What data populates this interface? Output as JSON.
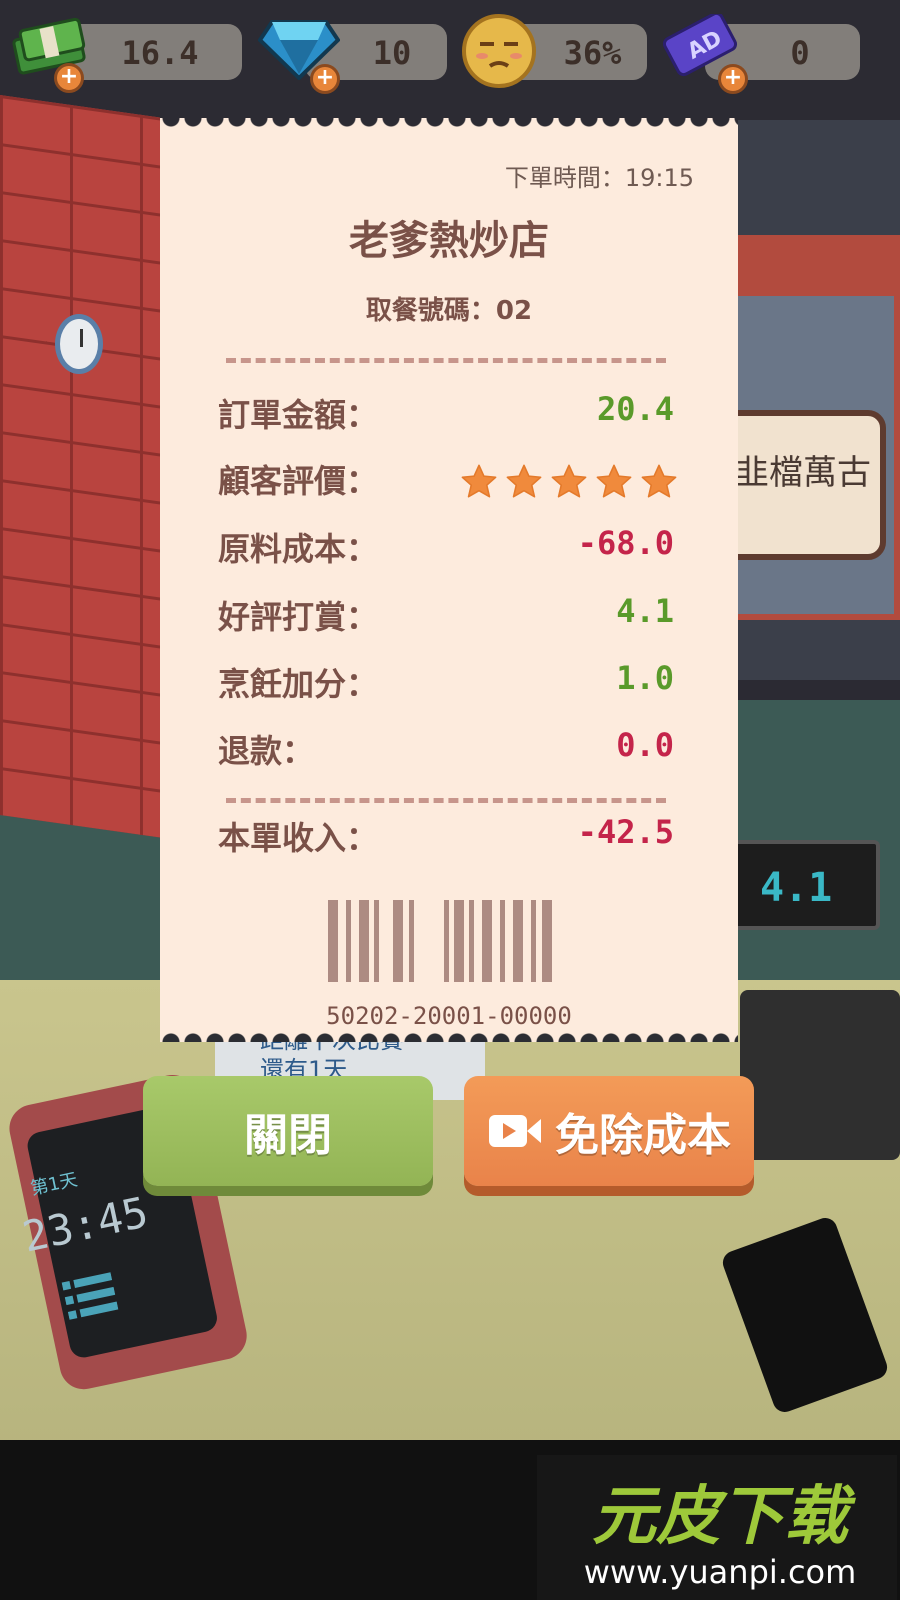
{
  "hud": {
    "cash": "16.4",
    "gems": "10",
    "mood": "36%",
    "ad_tickets": "0",
    "plus_symbol": "+",
    "ad_logo_text": "AD",
    "icons": [
      "cash-icon",
      "gem-icon",
      "mood-face-icon",
      "ad-ticket-icon",
      "plus-icon"
    ]
  },
  "background": {
    "sign_text": "韭檔萬古",
    "display_value": "4.1",
    "behind_text_line1": "距離下次比賽",
    "behind_text_line2": "還有1天",
    "tablet_day": "第1天",
    "tablet_time": "23:45"
  },
  "receipt": {
    "order_time_label": "下單時間：",
    "order_time": "19:15",
    "shop_name": "老爹熱炒店",
    "pickup_label": "取餐號碼：",
    "pickup_number": "02",
    "rows": [
      {
        "label": "訂單金額：",
        "value": "20.4"
      },
      {
        "label": "顧客評價：",
        "rating": 5,
        "max_rating": 5
      },
      {
        "label": "原料成本：",
        "value": "-68.0"
      },
      {
        "label": "好評打賞：",
        "value": "4.1"
      },
      {
        "label": "烹飪加分：",
        "value": "1.0"
      },
      {
        "label": "退款：",
        "value": "0.0"
      }
    ],
    "total_label": "本單收入：",
    "total_value": "-42.5",
    "barcode_number": "50202-20001-00000"
  },
  "buttons": {
    "close_label": "關閉",
    "free_cost_label": "免除成本"
  },
  "watermark": {
    "main": "元皮下载",
    "url": "www.yuanpi.com"
  },
  "colors": {
    "positive": "#5a9a2a",
    "negative": "#c4244a",
    "receipt_bg": "#fdebdd",
    "star": "#f08a3c",
    "close_button": "#a8c96a",
    "free_button": "#f39b58"
  }
}
